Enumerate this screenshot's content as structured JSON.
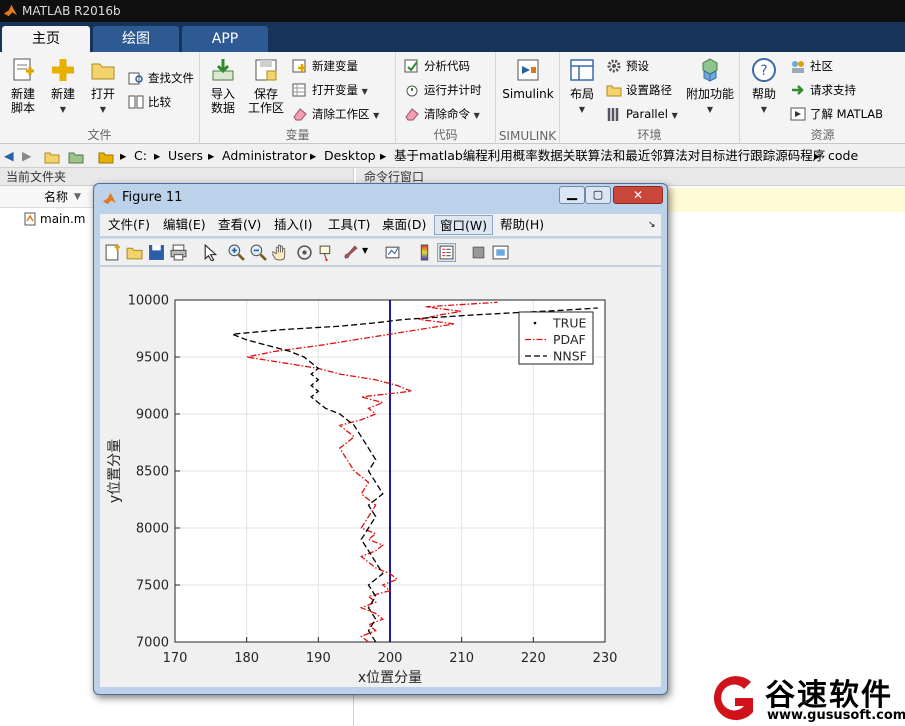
{
  "app": {
    "title": "MATLAB R2016b"
  },
  "tabs": [
    {
      "label": "主页",
      "active": true
    },
    {
      "label": "绘图",
      "active": false
    },
    {
      "label": "APP",
      "active": false
    }
  ],
  "ribbon": {
    "groups": [
      {
        "label": "文件"
      },
      {
        "label": "变量"
      },
      {
        "label": "代码"
      },
      {
        "label": "SIMULINK"
      },
      {
        "label": "环境"
      },
      {
        "label": "资源"
      }
    ],
    "file": {
      "new_script": "新建\n脚本",
      "new": "新建",
      "open": "打开",
      "find_files": "查找文件",
      "compare": "比较"
    },
    "variable": {
      "import": "导入\n数据",
      "save_ws": "保存\n工作区",
      "new_var": "新建变量",
      "open_var": "打开变量",
      "clear_ws": "清除工作区"
    },
    "code": {
      "analyze": "分析代码",
      "run_time": "运行并计时",
      "clear_cmd": "清除命令"
    },
    "simulink": {
      "label": "Simulink"
    },
    "env": {
      "layout": "布局",
      "prefs": "预设",
      "set_path": "设置路径",
      "parallel": "Parallel",
      "addons": "附加功能"
    },
    "resources": {
      "help": "帮助",
      "community": "社区",
      "support": "请求支持",
      "learn": "了解 MATLAB"
    }
  },
  "address": {
    "crumbs": [
      "C:",
      "Users",
      "Administrator",
      "Desktop",
      "基于matlab编程利用概率数据关联算法和最近邻算法对目标进行跟踪源码程序",
      "code"
    ]
  },
  "filepanel": {
    "title": "当前文件夹",
    "col_name": "名称",
    "files": [
      "main.m"
    ]
  },
  "cmdpanel": {
    "title": "命令行窗口"
  },
  "figure": {
    "title": "Figure 11",
    "menu": [
      "文件(F)",
      "编辑(E)",
      "查看(V)",
      "插入(I)",
      "工具(T)",
      "桌面(D)",
      "窗口(W)",
      "帮助(H)"
    ]
  },
  "brand": {
    "name": "谷速软件",
    "url": "www.gususoft.com",
    "color": "#d0121b"
  },
  "chart_data": {
    "type": "line",
    "xlabel": "x位置分量",
    "ylabel": "y位置分量",
    "xlim": [
      170,
      230
    ],
    "ylim": [
      7000,
      10000
    ],
    "xticks": [
      170,
      180,
      190,
      200,
      210,
      220,
      230
    ],
    "yticks": [
      7000,
      7500,
      8000,
      8500,
      9000,
      9500,
      10000
    ],
    "grid": true,
    "legend_position": "top-right",
    "series": [
      {
        "name": "TRUE",
        "color": "#0000a0",
        "style": "solid",
        "points": [
          [
            200,
            7000
          ],
          [
            200,
            10000
          ]
        ]
      },
      {
        "name": "PDAF",
        "color": "#e01010",
        "style": "dashdot",
        "points": [
          [
            197,
            7000
          ],
          [
            196,
            7050
          ],
          [
            198,
            7100
          ],
          [
            197,
            7150
          ],
          [
            199,
            7200
          ],
          [
            198,
            7250
          ],
          [
            196,
            7300
          ],
          [
            198,
            7350
          ],
          [
            197,
            7400
          ],
          [
            200,
            7450
          ],
          [
            199,
            7500
          ],
          [
            201,
            7550
          ],
          [
            200,
            7600
          ],
          [
            198,
            7650
          ],
          [
            197,
            7700
          ],
          [
            196,
            7750
          ],
          [
            198,
            7800
          ],
          [
            199,
            7850
          ],
          [
            197,
            7900
          ],
          [
            198,
            7950
          ],
          [
            196,
            8000
          ],
          [
            197,
            8100
          ],
          [
            198,
            8200
          ],
          [
            196,
            8300
          ],
          [
            197,
            8400
          ],
          [
            195,
            8500
          ],
          [
            194,
            8600
          ],
          [
            193,
            8700
          ],
          [
            195,
            8800
          ],
          [
            193,
            8900
          ],
          [
            196,
            8950
          ],
          [
            198,
            9000
          ],
          [
            197,
            9050
          ],
          [
            199,
            9100
          ],
          [
            196,
            9150
          ],
          [
            203,
            9200
          ],
          [
            201,
            9250
          ],
          [
            198,
            9300
          ],
          [
            193,
            9350
          ],
          [
            190,
            9400
          ],
          [
            185,
            9450
          ],
          [
            180,
            9500
          ],
          [
            184,
            9550
          ],
          [
            190,
            9600
          ],
          [
            195,
            9650
          ],
          [
            200,
            9700
          ],
          [
            205,
            9750
          ],
          [
            209,
            9790
          ],
          [
            204,
            9830
          ],
          [
            207,
            9870
          ],
          [
            210,
            9900
          ],
          [
            205,
            9940
          ],
          [
            215,
            9980
          ]
        ]
      },
      {
        "name": "NNSF",
        "color": "#000000",
        "style": "dashed",
        "points": [
          [
            198,
            7000
          ],
          [
            197,
            7100
          ],
          [
            198,
            7200
          ],
          [
            197,
            7300
          ],
          [
            198,
            7400
          ],
          [
            197,
            7500
          ],
          [
            199,
            7600
          ],
          [
            198,
            7700
          ],
          [
            197,
            7800
          ],
          [
            196,
            7900
          ],
          [
            197,
            8000
          ],
          [
            198,
            8100
          ],
          [
            197,
            8200
          ],
          [
            199,
            8300
          ],
          [
            198,
            8400
          ],
          [
            197,
            8500
          ],
          [
            198,
            8600
          ],
          [
            197,
            8700
          ],
          [
            196,
            8800
          ],
          [
            195,
            8900
          ],
          [
            194,
            8950
          ],
          [
            193,
            9000
          ],
          [
            191,
            9050
          ],
          [
            190,
            9100
          ],
          [
            189,
            9150
          ],
          [
            190,
            9200
          ],
          [
            189,
            9250
          ],
          [
            190,
            9300
          ],
          [
            189,
            9350
          ],
          [
            190,
            9400
          ],
          [
            189,
            9450
          ],
          [
            188,
            9500
          ],
          [
            186,
            9550
          ],
          [
            183,
            9600
          ],
          [
            180,
            9650
          ],
          [
            178,
            9700
          ],
          [
            185,
            9740
          ],
          [
            193,
            9770
          ],
          [
            198,
            9800
          ],
          [
            202,
            9830
          ],
          [
            207,
            9850
          ],
          [
            212,
            9870
          ],
          [
            218,
            9890
          ],
          [
            224,
            9910
          ],
          [
            229,
            9930
          ]
        ]
      }
    ]
  }
}
